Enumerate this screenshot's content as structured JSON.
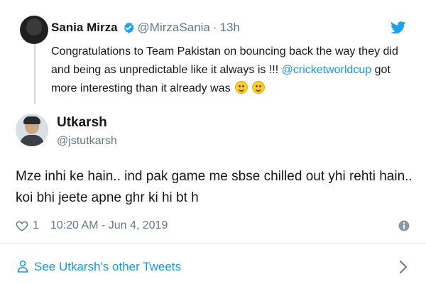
{
  "quoted_tweet": {
    "name": "Sania Mirza",
    "handle": "@MirzaSania",
    "separator": "·",
    "time": "13h",
    "text_before_link": "Congratulations to Team Pakistan on bouncing back the way they did and being as unpredictable like it always is !!! ",
    "link": "@cricketworldcup",
    "text_after_link": " got more interesting than it already was ",
    "emojis": [
      "relieved-face-emoji",
      "grinning-face-emoji"
    ]
  },
  "author": {
    "name": "Utkarsh",
    "handle": "@jstutkarsh"
  },
  "tweet": {
    "text": "Mze inhi ke hain.. ind pak game me sbse chilled out yhi rehti hain.. koi bhi jeete apne ghr ki hi bt h"
  },
  "meta": {
    "like_count": "1",
    "timestamp": "10:20 AM - Jun 4, 2019"
  },
  "footer": {
    "see_other_label": "See Utkarsh's other Tweets"
  },
  "colors": {
    "link": "#1b95e0",
    "secondary_text": "#657786",
    "divider": "#e1e8ed"
  }
}
